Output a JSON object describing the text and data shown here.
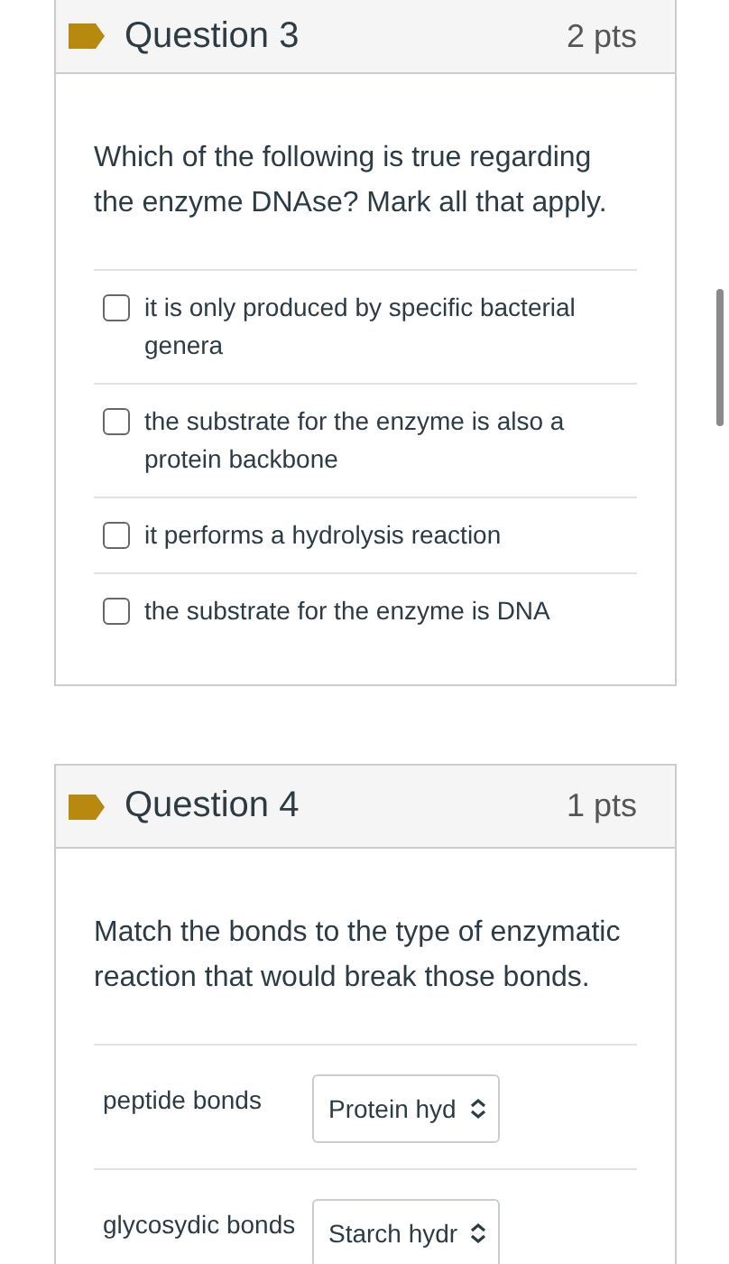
{
  "questions": [
    {
      "title": "Question 3",
      "points": "2 pts",
      "prompt": "Which of the following is true regarding the enzyme DNAse? Mark all that apply.",
      "kind": "multiple",
      "options": [
        {
          "label": "it is only produced by specific bacterial genera",
          "checked": false
        },
        {
          "label": "the substrate for the enzyme is also a protein backbone",
          "checked": false
        },
        {
          "label": "it performs a hydrolysis reaction",
          "checked": false
        },
        {
          "label": "the substrate for the enzyme is DNA",
          "checked": false
        }
      ]
    },
    {
      "title": "Question 4",
      "points": "1 pts",
      "prompt": "Match the bonds to the type of enzymatic reaction that would break those bonds.",
      "kind": "matching",
      "pairs": [
        {
          "label": "peptide bonds",
          "value": "Protein hyd"
        },
        {
          "label": "glycosydic bonds",
          "value": "Starch hydr"
        }
      ]
    }
  ]
}
